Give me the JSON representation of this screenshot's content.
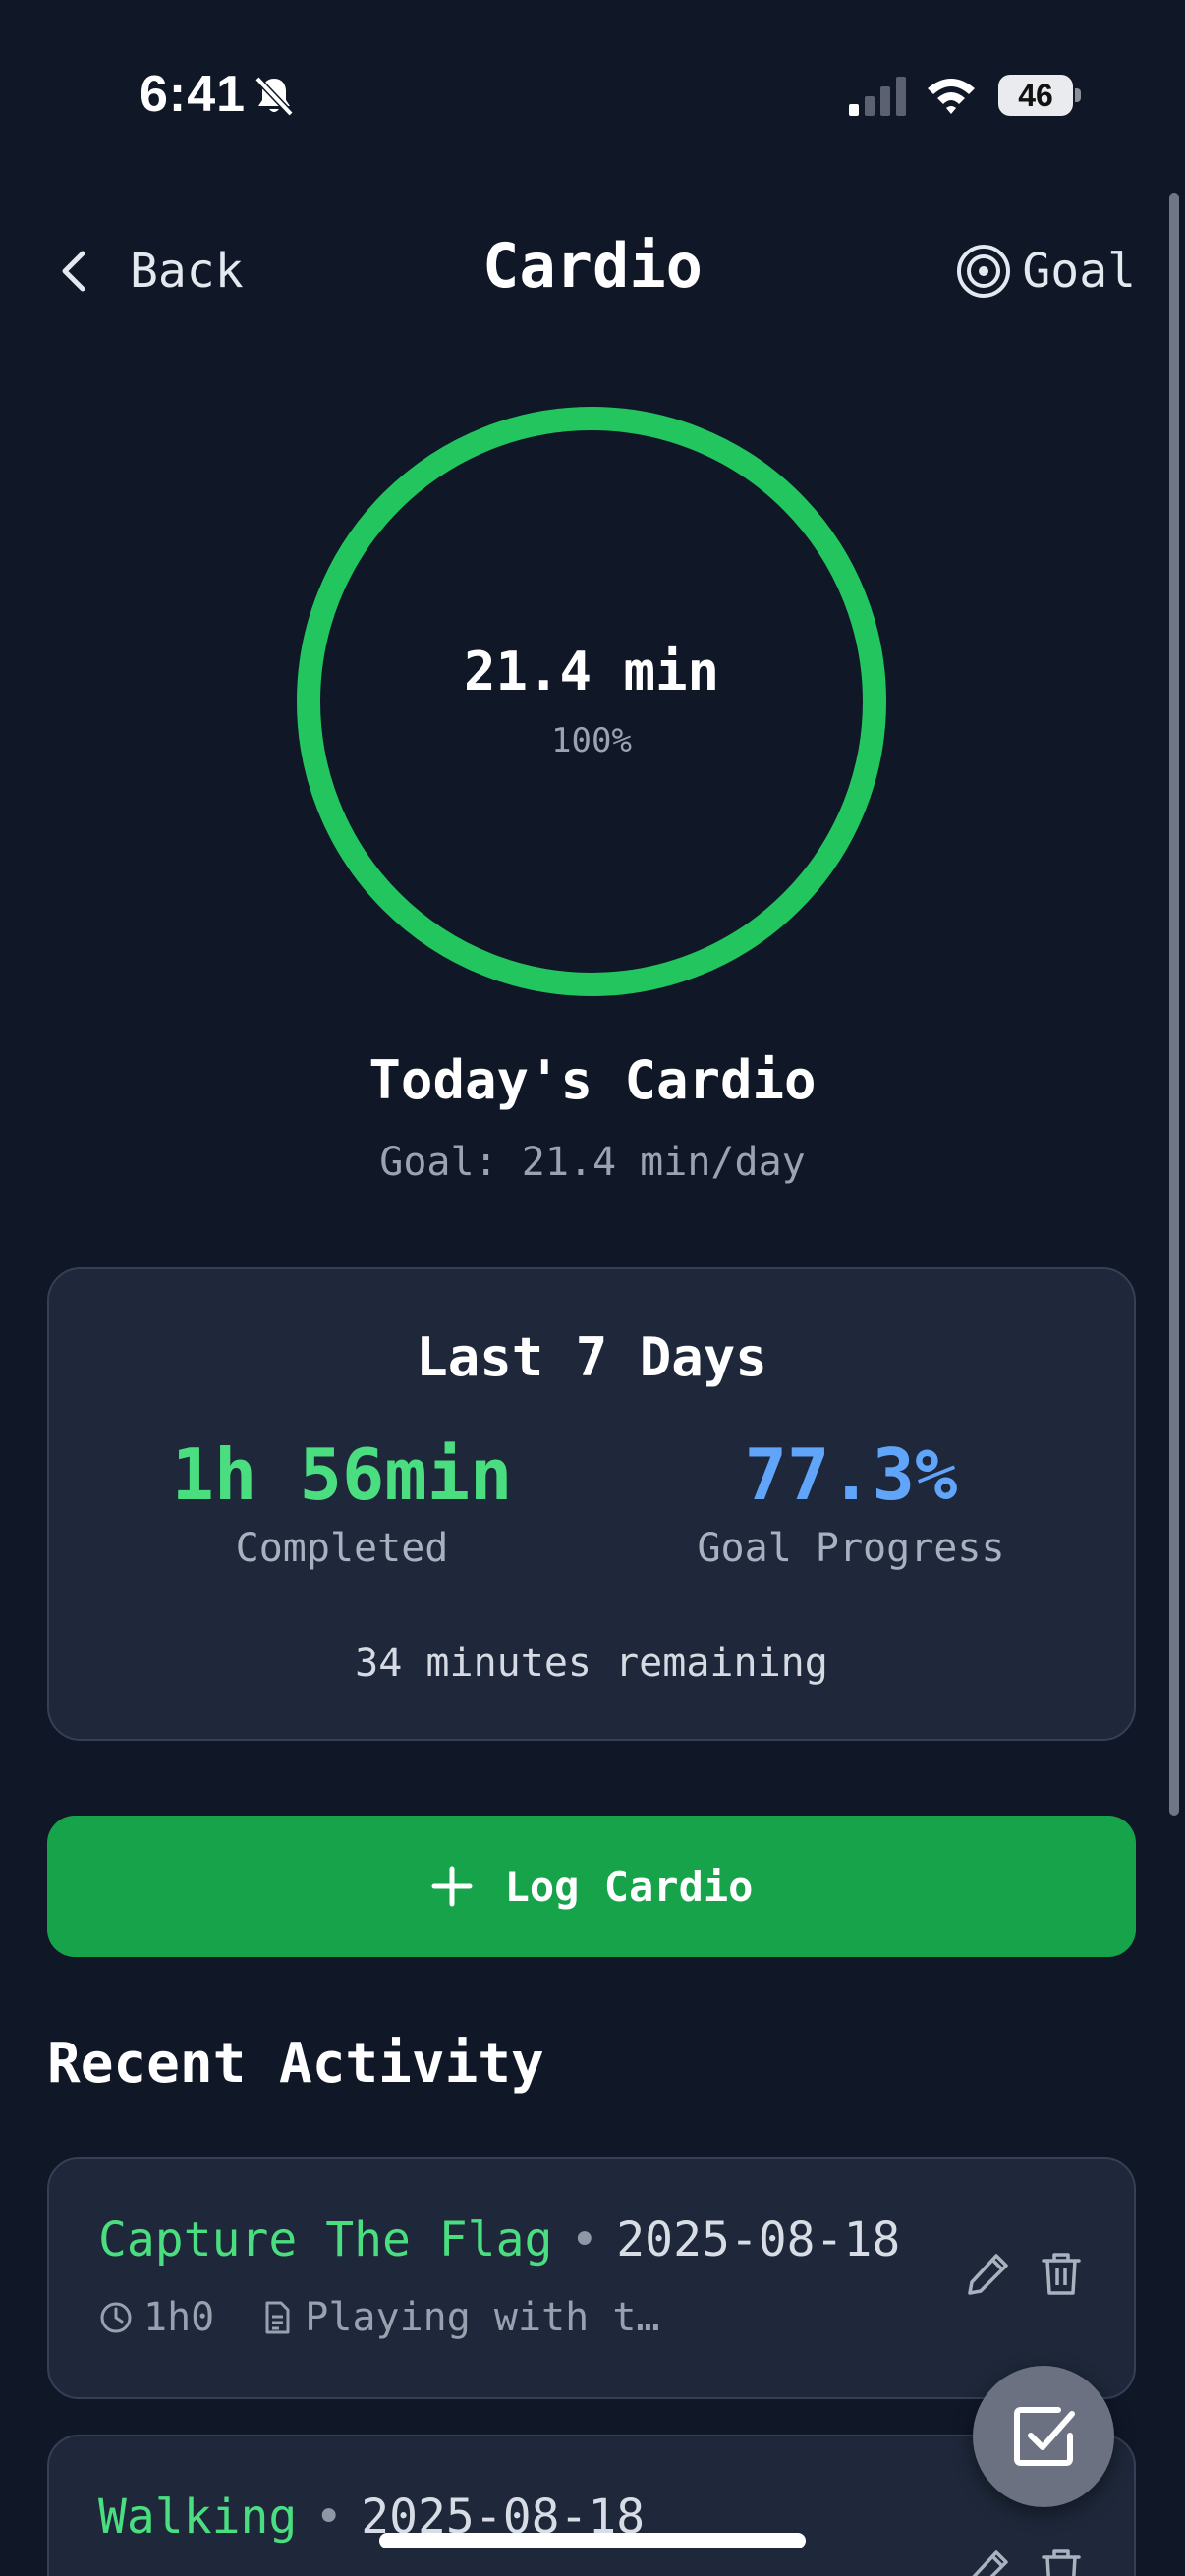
{
  "status_bar": {
    "time": "6:41",
    "battery": "46"
  },
  "header": {
    "back_label": "Back",
    "title": "Cardio",
    "goal_label": "Goal"
  },
  "progress": {
    "value_label": "21.4 min",
    "percent_label": "100%",
    "fraction": 1.0,
    "ring_color": "#22c55e"
  },
  "today": {
    "title": "Today's Cardio",
    "goal": "Goal: 21.4 min/day"
  },
  "last7": {
    "title": "Last 7 Days",
    "completed_value": "1h 56min",
    "completed_label": "Completed",
    "progress_value": "77.3%",
    "progress_label": "Goal Progress",
    "remaining": "34 minutes remaining"
  },
  "log_button": {
    "label": "Log Cardio"
  },
  "recent": {
    "title": "Recent Activity",
    "items": [
      {
        "name": "Capture The Flag",
        "separator": "•",
        "date": "2025-08-18",
        "duration": "1h0",
        "note": "Playing with t…"
      },
      {
        "name": "Walking",
        "separator": "•",
        "date": "2025-08-18"
      }
    ]
  },
  "colors": {
    "background": "#101727",
    "card": "#1e283a",
    "accent_green": "#4ade80",
    "accent_blue": "#60a5fa",
    "button_green": "#16a34a"
  }
}
